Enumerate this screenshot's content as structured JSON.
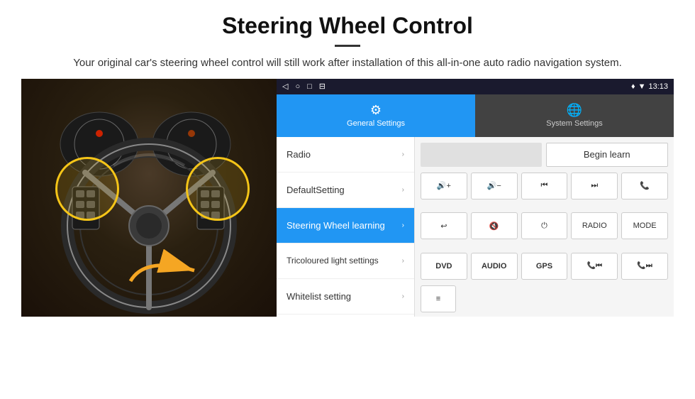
{
  "header": {
    "title": "Steering Wheel Control",
    "subtitle": "Your original car's steering wheel control will still work after installation of this all-in-one auto radio navigation system."
  },
  "status_bar": {
    "time": "13:13",
    "icons": [
      "◁",
      "○",
      "□",
      "⊟"
    ]
  },
  "tabs": [
    {
      "label": "General Settings",
      "active": true
    },
    {
      "label": "System Settings",
      "active": false
    }
  ],
  "menu_items": [
    {
      "label": "Radio",
      "active": false
    },
    {
      "label": "DefaultSetting",
      "active": false
    },
    {
      "label": "Steering Wheel learning",
      "active": true
    },
    {
      "label": "Tricoloured light settings",
      "active": false
    },
    {
      "label": "Whitelist setting",
      "active": false
    }
  ],
  "right_panel": {
    "begin_learn_label": "Begin learn",
    "buttons_row1": [
      {
        "label": "🔊+",
        "type": "icon"
      },
      {
        "label": "🔊-",
        "type": "icon"
      },
      {
        "label": "⏮",
        "type": "icon"
      },
      {
        "label": "⏭",
        "type": "icon"
      },
      {
        "label": "📞",
        "type": "icon"
      }
    ],
    "buttons_row2": [
      {
        "label": "↩",
        "type": "icon"
      },
      {
        "label": "🔇",
        "type": "icon"
      },
      {
        "label": "⏻",
        "type": "icon"
      },
      {
        "label": "RADIO",
        "type": "text"
      },
      {
        "label": "MODE",
        "type": "text"
      }
    ],
    "buttons_row3": [
      {
        "label": "DVD",
        "type": "text"
      },
      {
        "label": "AUDIO",
        "type": "text"
      },
      {
        "label": "GPS",
        "type": "text"
      },
      {
        "label": "📞⏮",
        "type": "icon"
      },
      {
        "label": "📞⏭",
        "type": "icon"
      }
    ],
    "list_icon_btn": "≡"
  }
}
